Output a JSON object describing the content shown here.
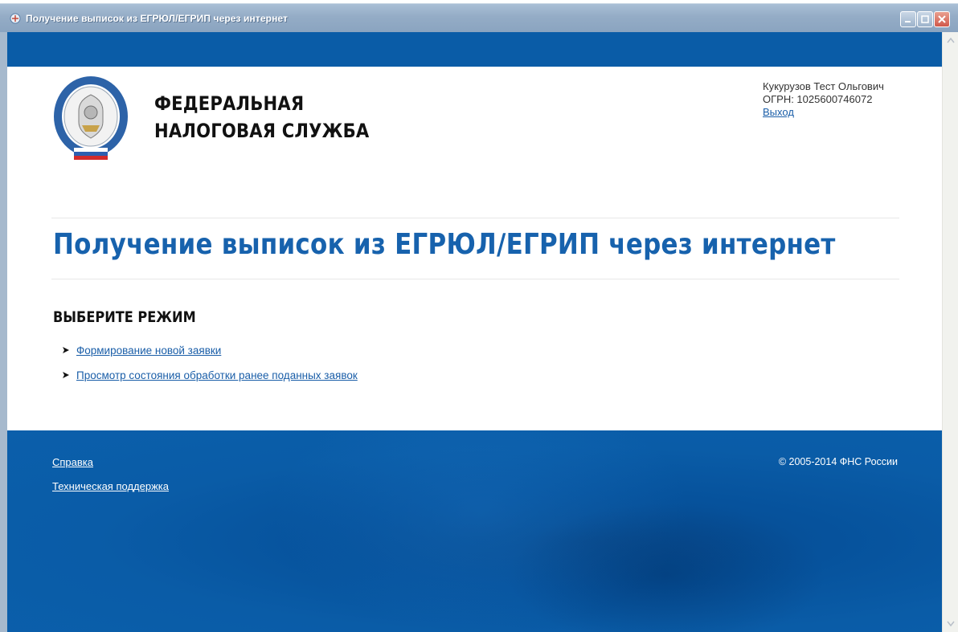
{
  "window": {
    "title": "Получение выписок из ЕГРЮЛ/ЕГРИП через интернет",
    "controls": [
      "minimize",
      "maximize",
      "close"
    ]
  },
  "header": {
    "logo_line1": "ФЕДЕРАЛЬНАЯ",
    "logo_line2": "НАЛОГОВАЯ СЛУЖБА",
    "emblem_text": "ФЕДЕРАЛЬНАЯ НАЛОГОВАЯ СЛУЖБА",
    "user_name": "Кукурузов Тест Ольгович",
    "ogrn": "ОГРН: 1025600746072",
    "logout_label": "Выход"
  },
  "main": {
    "title": "Получение выписок из ЕГРЮЛ/ЕГРИП через интернет",
    "section_heading": "ВЫБЕРИТЕ РЕЖИМ",
    "modes": [
      {
        "label": "Формирование новой заявки"
      },
      {
        "label": "Просмотр состояния обработки ранее поданных заявок"
      }
    ]
  },
  "footer": {
    "help_label": "Справка",
    "support_label": "Техническая поддержка",
    "copyright": "© 2005-2014 ФНС России"
  },
  "colors": {
    "brand_blue": "#0a5ca7",
    "title_blue": "#1762ad",
    "link_blue": "#1a5ea8"
  }
}
